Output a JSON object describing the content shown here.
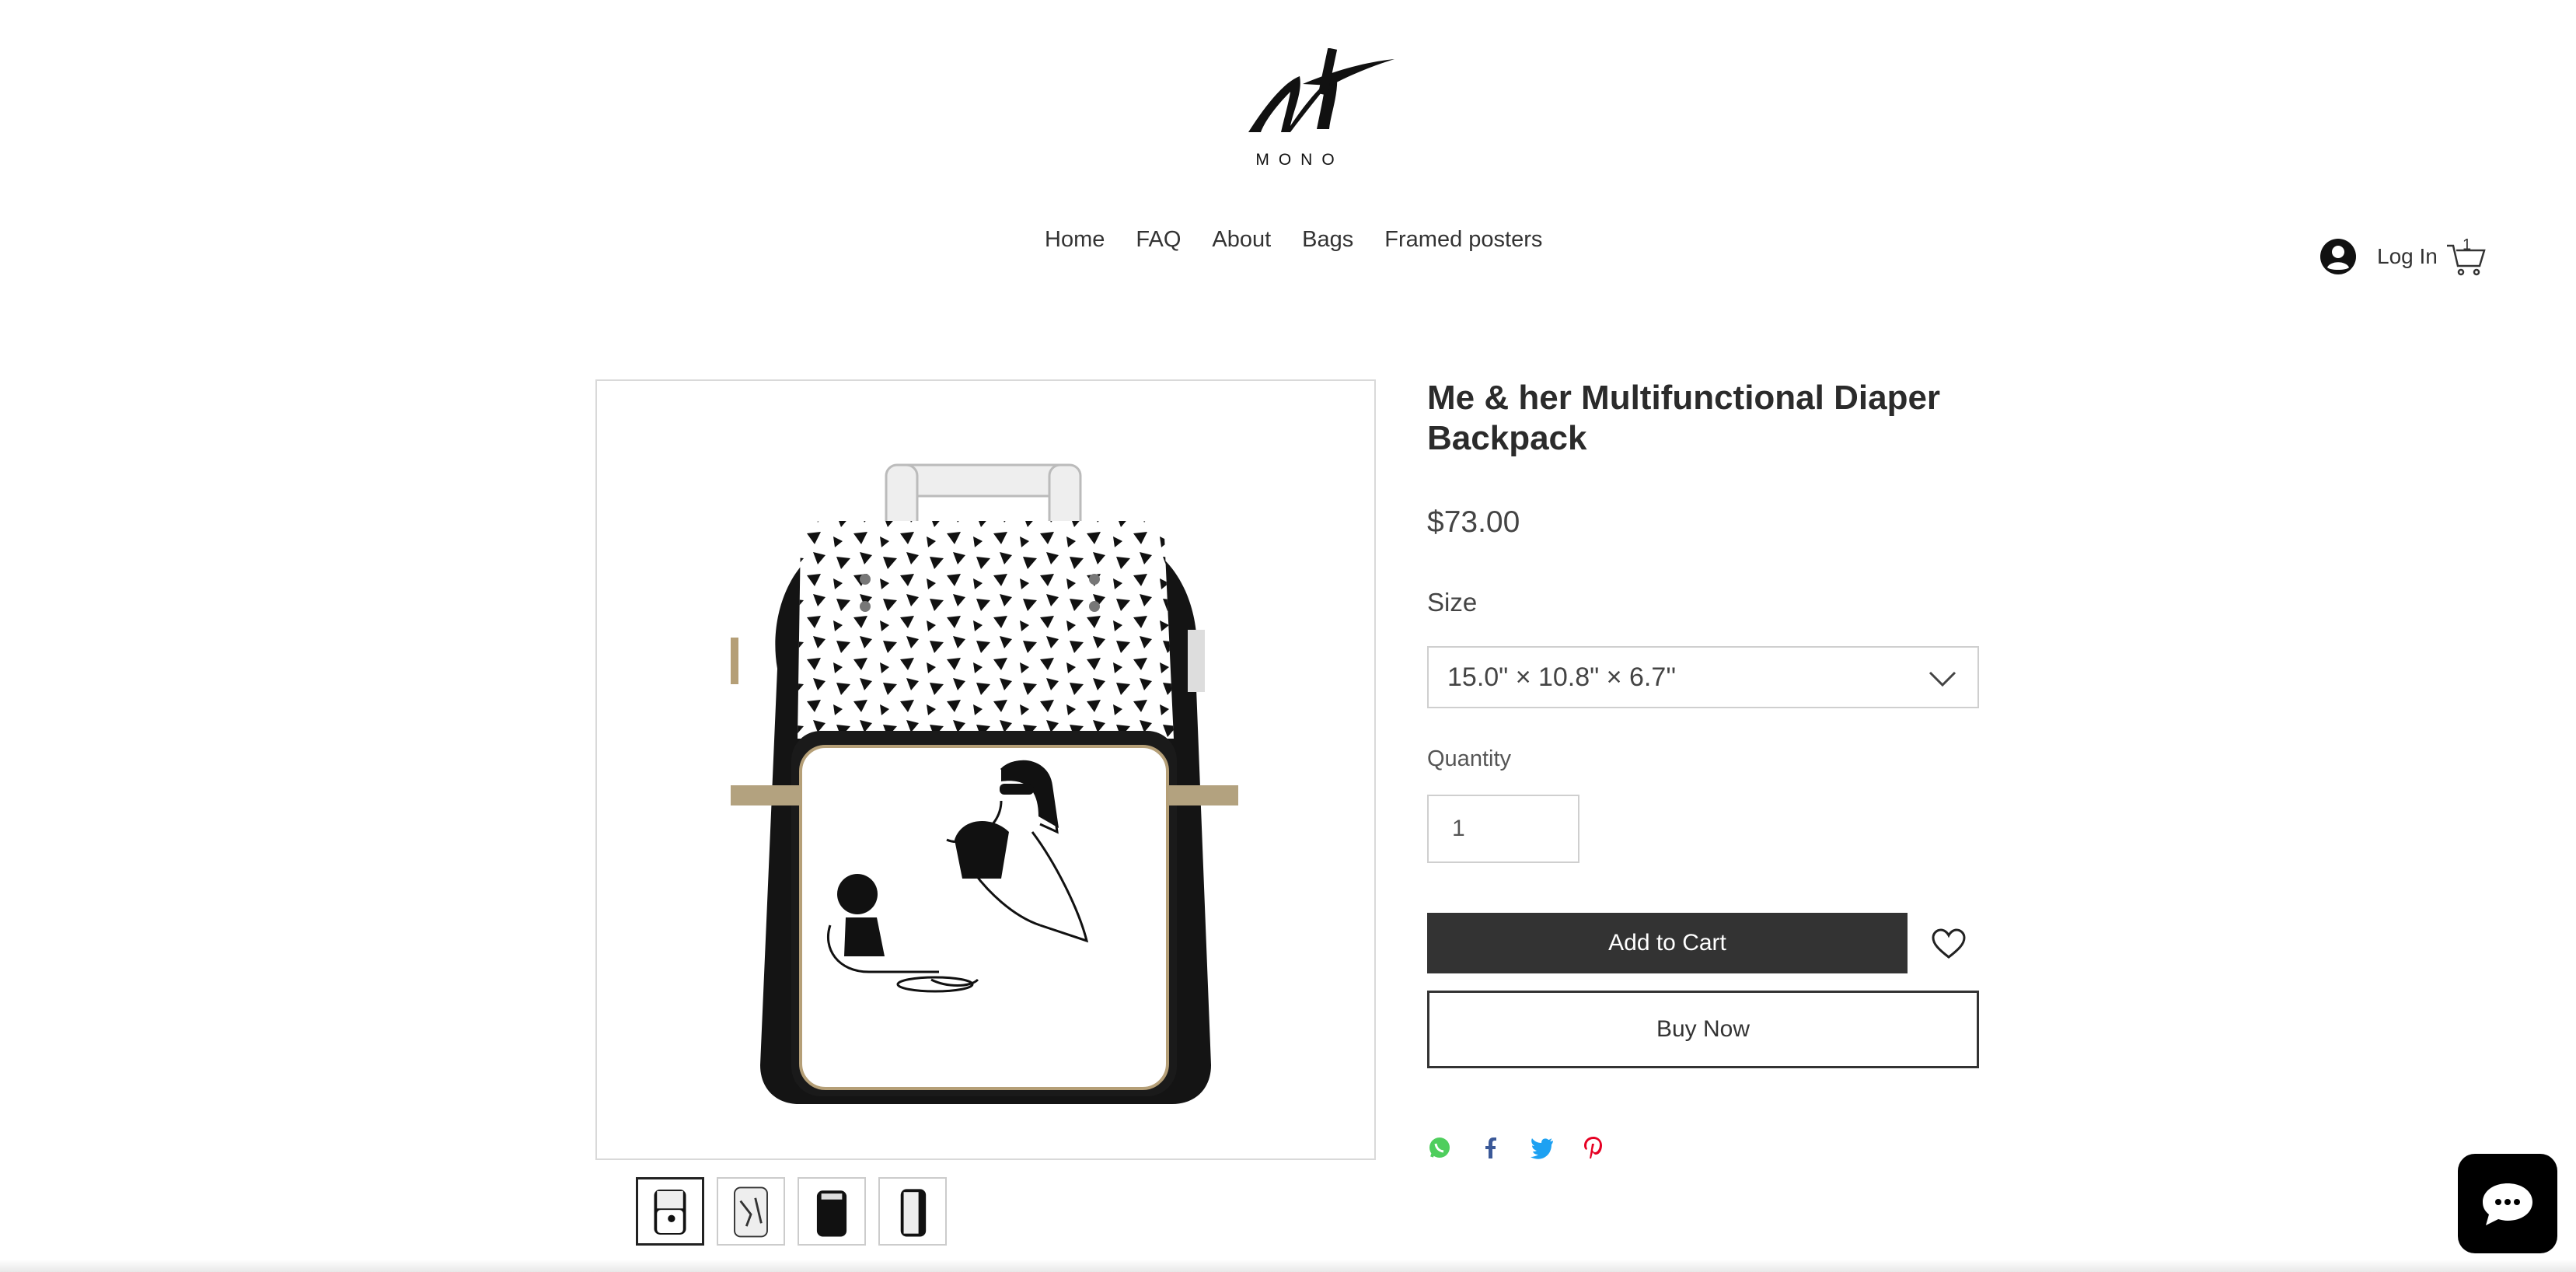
{
  "header": {
    "brand": "MONO",
    "nav": [
      "Home",
      "FAQ",
      "About",
      "Bags",
      "Framed posters"
    ],
    "login_label": "Log In",
    "cart_count": "1"
  },
  "product": {
    "title": "Me & her Multifunctional Diaper Backpack",
    "price": "$73.00",
    "size_label": "Size",
    "size_value": "15.0\" × 10.8\" × 6.7''",
    "quantity_label": "Quantity",
    "quantity_value": "1",
    "add_to_cart_label": "Add to Cart",
    "buy_now_label": "Buy Now",
    "thumbnail_count": 4,
    "active_thumbnail": 1
  },
  "share": {
    "icons": [
      "whatsapp-icon",
      "facebook-icon",
      "twitter-icon",
      "pinterest-icon"
    ],
    "colors": {
      "whatsapp": "#4fce5d",
      "facebook": "#3b5998",
      "twitter": "#1da1f2",
      "pinterest": "#e60023"
    }
  },
  "colors": {
    "add_to_cart_bg": "#333333",
    "chat_bg": "#000000"
  }
}
